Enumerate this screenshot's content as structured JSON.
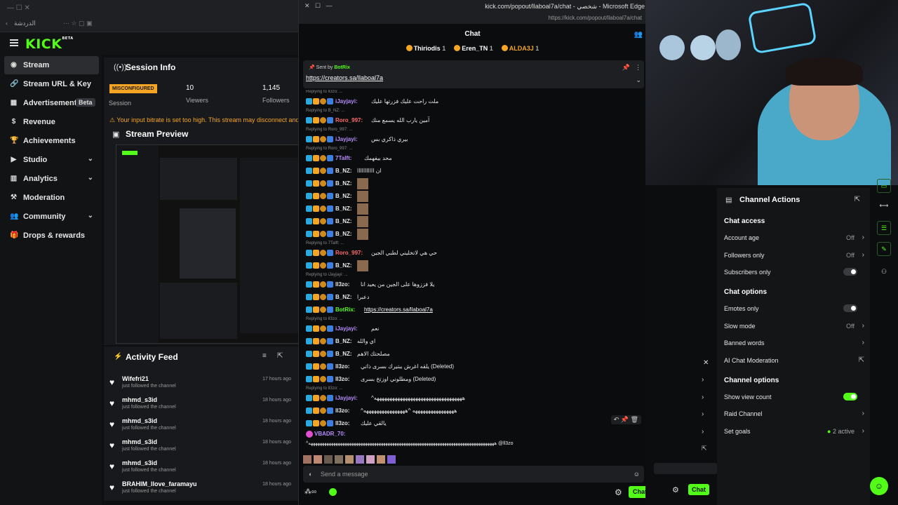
{
  "browser": {
    "tab_label": "الدردشة",
    "chat_window_title": "kick.com/popout/llaboal7a/chat - شخصي - Microsoft Edge",
    "chat_url": "https://kick.com/popout/llaboal7a/chat"
  },
  "logo": {
    "text": "KICK",
    "beta": "BETA"
  },
  "sidebar": {
    "items": [
      {
        "label": "Stream",
        "icon": "stream-icon",
        "active": true
      },
      {
        "label": "Stream URL & Key",
        "icon": "link-icon"
      },
      {
        "label": "Advertisement",
        "icon": "ad-icon",
        "badge": "Beta"
      },
      {
        "label": "Revenue",
        "icon": "dollar-icon"
      },
      {
        "label": "Achievements",
        "icon": "trophy-icon"
      },
      {
        "label": "Studio",
        "icon": "studio-icon",
        "chevron": true
      },
      {
        "label": "Analytics",
        "icon": "analytics-icon",
        "chevron": true
      },
      {
        "label": "Moderation",
        "icon": "hammer-icon"
      },
      {
        "label": "Community",
        "icon": "people-icon",
        "chevron": true
      },
      {
        "label": "Drops & rewards",
        "icon": "gift-icon"
      }
    ]
  },
  "session": {
    "title": "Session Info",
    "status": "MISCONFIGURED",
    "status_label": "Session",
    "viewers": "10",
    "viewers_label": "Viewers",
    "followers": "1,145",
    "followers_label": "Followers",
    "warning": "Your input bitrate is set too high. This stream may disconnect and wi"
  },
  "preview": {
    "title": "Stream Preview"
  },
  "activity": {
    "title": "Activity Feed",
    "items": [
      {
        "name": "Wifefri21",
        "sub": "just followed the channel",
        "time": "17 hours ago"
      },
      {
        "name": "mhmd_s3id",
        "sub": "just followed the channel",
        "time": "18 hours ago"
      },
      {
        "name": "mhmd_s3id",
        "sub": "just followed the channel",
        "time": "18 hours ago"
      },
      {
        "name": "mhmd_s3id",
        "sub": "just followed the channel",
        "time": "18 hours ago"
      },
      {
        "name": "mhmd_s3id",
        "sub": "just followed the channel",
        "time": "18 hours ago"
      },
      {
        "name": "BRAHIM_llove_faramayu",
        "sub": "just followed the channel",
        "time": "18 hours ago"
      }
    ]
  },
  "chat": {
    "header": "Chat",
    "gifters": [
      {
        "name": "Thiriodis",
        "count": "1"
      },
      {
        "name": "Eren_TN",
        "count": "1"
      },
      {
        "name": "ALDA3J",
        "count": "1"
      }
    ],
    "pinned": {
      "sent_by": "Sent by",
      "user": "BotRix",
      "link": "https://creators.sa/llaboal7a"
    },
    "messages": [
      {
        "reply": "Replying to ll3zo: ...",
        "user": "iJayjayi:",
        "color": "#b98cff",
        "text": "ملت راحت عليك فزرتها عليك"
      },
      {
        "reply": "Replying to B_NZ: ...",
        "user": "Roro_997:",
        "color": "#ff6b6b",
        "text": "آمين يارب الله يسمع منك"
      },
      {
        "reply": "Replying to Roro_997: ...",
        "user": "iJayjayi:",
        "color": "#b98cff",
        "text": "بيري ذاكري بس"
      },
      {
        "reply": "Replying to Roro_997: ...",
        "user": "7Talft:",
        "color": "#b98cff",
        "text": "محد بيفهمك"
      },
      {
        "reply": "",
        "user": "B_NZ:",
        "color": "#e8e8e8",
        "text": "ان ااااااااااا"
      },
      {
        "reply": "",
        "user": "B_NZ:",
        "color": "#e8e8e8",
        "text": "",
        "emote": true
      },
      {
        "reply": "",
        "user": "B_NZ:",
        "color": "#e8e8e8",
        "text": "",
        "emote": true
      },
      {
        "reply": "",
        "user": "B_NZ:",
        "color": "#e8e8e8",
        "text": "",
        "emote": true
      },
      {
        "reply": "",
        "user": "B_NZ:",
        "color": "#e8e8e8",
        "text": "",
        "emote": true
      },
      {
        "reply": "",
        "user": "B_NZ:",
        "color": "#e8e8e8",
        "text": "",
        "emote": true
      },
      {
        "reply": "Replying to 7Talft: ...",
        "user": "Roro_997:",
        "color": "#ff6b6b",
        "text": "حي هي لاتخليني لطبي الجين"
      },
      {
        "reply": "",
        "user": "B_NZ:",
        "color": "#e8e8e8",
        "text": "",
        "emote": true
      },
      {
        "reply": "Replying to iJayjayi: ...",
        "user": "ll3zo:",
        "color": "#e8e8e8",
        "text": "يلا فززوها على الجين من يعيد انا"
      },
      {
        "reply": "",
        "user": "B_NZ:",
        "color": "#e8e8e8",
        "text": "دعبرا"
      },
      {
        "reply": "",
        "user": "BotRix:",
        "color": "#53fc18",
        "text": "https://creators.sa/llaboal7a",
        "link": true
      },
      {
        "reply": "Replying to ll3zo: ...",
        "user": "iJayjayi:",
        "color": "#b98cff",
        "text": "نعم"
      },
      {
        "reply": "",
        "user": "B_NZ:",
        "color": "#e8e8e8",
        "text": "اي والله"
      },
      {
        "reply": "",
        "user": "B_NZ:",
        "color": "#e8e8e8",
        "text": "مصلحتك الاهم"
      },
      {
        "reply": "",
        "user": "ll3zo:",
        "color": "#e8e8e8",
        "text": "يلقه اغرش ببتيرك بسرى ذاتي (Deleted)"
      },
      {
        "reply": "",
        "user": "ll3zo:",
        "color": "#e8e8e8",
        "text": "ومطلوني اوزتخ بسرى (Deleted)"
      },
      {
        "reply": "Replying to ll3zo: ...",
        "user": "iJayjayi:",
        "color": "#b98cff",
        "text": "^ههههههههههههههههههههههههههههههههههه"
      },
      {
        "reply": "",
        "user": "ll3zo:",
        "color": "#e8e8e8",
        "text": "^ههههههههههههههههه ^ههههههههههههههههه"
      },
      {
        "reply": "",
        "user": "ll3zo:",
        "color": "#e8e8e8",
        "text": "يالقي عليك"
      }
    ],
    "last_user": "VBADR_70:",
    "last_text": "^ههههههههههههههههههههههههههههههههههههههههههههههههههههههههههههههههههههههههههههههههههه @ll3zo",
    "input_placeholder": "Send a message",
    "chat_button": "Chat"
  },
  "channel_actions": {
    "title": "Channel Actions",
    "sections": [
      {
        "kind": "section",
        "label": "Chat access"
      },
      {
        "kind": "value",
        "label": "Account age",
        "value": "Off"
      },
      {
        "kind": "value",
        "label": "Followers only",
        "value": "Off"
      },
      {
        "kind": "toggle",
        "label": "Subscribers only",
        "on": false
      },
      {
        "kind": "section",
        "label": "Chat options"
      },
      {
        "kind": "toggle",
        "label": "Emotes only",
        "on": false
      },
      {
        "kind": "value",
        "label": "Slow mode",
        "value": "Off"
      },
      {
        "kind": "value",
        "label": "Banned words",
        "value": ""
      },
      {
        "kind": "link",
        "label": "AI Chat Moderation"
      },
      {
        "kind": "section",
        "label": "Channel options"
      },
      {
        "kind": "toggle",
        "label": "Show view count",
        "on": true
      },
      {
        "kind": "value",
        "label": "Raid Channel",
        "value": ""
      },
      {
        "kind": "value",
        "label": "Set goals",
        "value": "2 active"
      }
    ],
    "chat_button": "Chat"
  },
  "colors": {
    "accent": "#53fc18",
    "warning": "#f5a524"
  }
}
